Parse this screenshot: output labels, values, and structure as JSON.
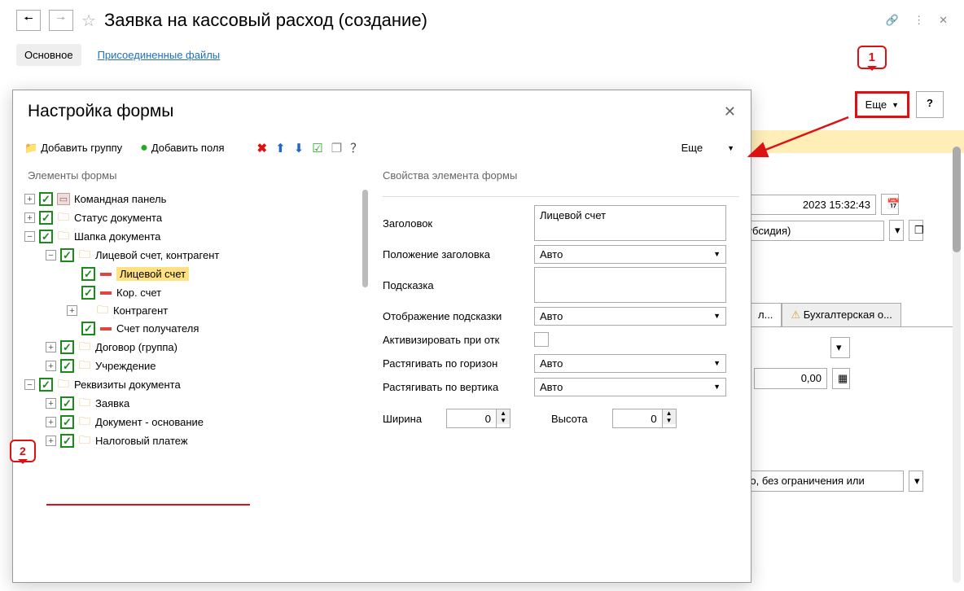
{
  "header": {
    "title": "Заявка на кассовый расход (создание)"
  },
  "tabs": {
    "main": "Основное",
    "attached": "Присоединенные файлы"
  },
  "toolbar": {
    "more": "Еще",
    "help": "?"
  },
  "callouts": {
    "c1": "1",
    "c2": "2"
  },
  "bg": {
    "datetime": "2023 15:32:43",
    "subsidy": "Субсидия)",
    "tab_l": "л...",
    "tab_r": "Бухгалтерская о...",
    "amount": "0,00",
    "limit_text": "ено, без ограничения или"
  },
  "dialog": {
    "title": "Настройка формы",
    "add_group": "Добавить группу",
    "add_fields": "Добавить поля",
    "more": "Еще",
    "tree_title": "Элементы формы",
    "props_title": "Свойства элемента формы",
    "nodes": {
      "cmd_panel": "Командная панель",
      "doc_status": "Статус документа",
      "doc_header": "Шапка документа",
      "acc_contr": "Лицевой счет, контрагент",
      "pers_acc": "Лицевой счет",
      "cor_acc": "Кор. счет",
      "contragent": "Контрагент",
      "recip_acc": "Счет получателя",
      "contract_grp": "Договор (группа)",
      "institution": "Учреждение",
      "doc_reqs": "Реквизиты документа",
      "request": "Заявка",
      "base_doc": "Документ - основание",
      "tax_pay": "Налоговый платеж"
    },
    "props": {
      "lbl_title": "Заголовок",
      "val_title": "Лицевой счет",
      "lbl_title_pos": "Положение заголовка",
      "val_auto": "Авто",
      "lbl_hint": "Подсказка",
      "lbl_hint_disp": "Отображение подсказки",
      "lbl_activate": "Активизировать при отк",
      "lbl_stretch_h": "Растягивать по горизон",
      "lbl_stretch_v": "Растягивать по вертика",
      "lbl_width": "Ширина",
      "val_width": "0",
      "lbl_height": "Высота",
      "val_height": "0"
    }
  }
}
